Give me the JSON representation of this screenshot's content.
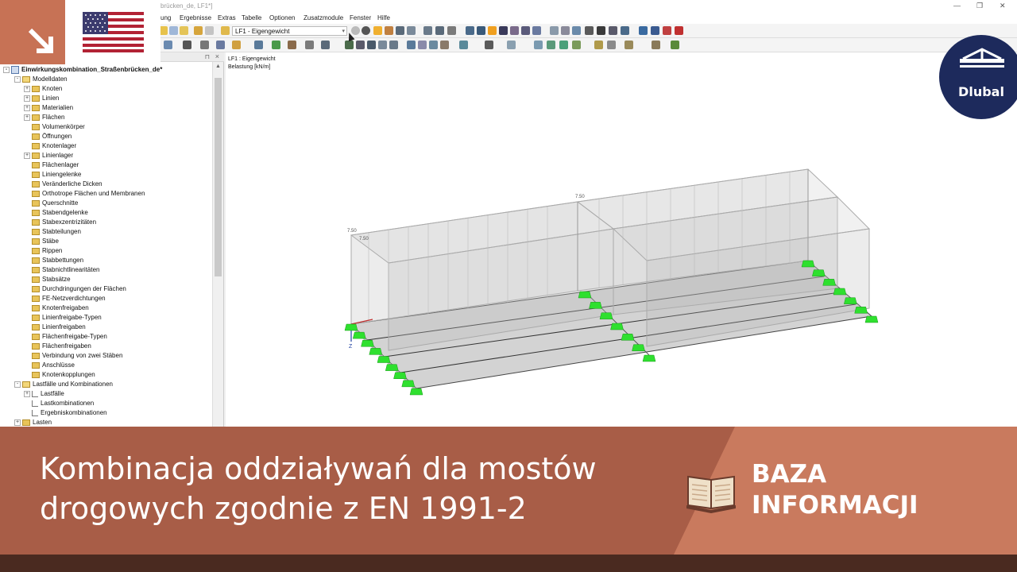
{
  "window": {
    "title": "brücken_de, LF1*]",
    "controls": [
      "—",
      "❐",
      "✕"
    ]
  },
  "menu": [
    "ung",
    "Ergebnisse",
    "Extras",
    "Tabelle",
    "Optionen",
    "Zusatzmodule",
    "Fenster",
    "Hilfe"
  ],
  "toolbar": {
    "loadcase_selected": "LF1 - Eigengewicht"
  },
  "navigator": {
    "root": "Einwirkungskombination_Straßenbrücken_de*",
    "items": [
      {
        "label": "Modelldaten",
        "level": 1,
        "type": "folder-open",
        "expander": "-"
      },
      {
        "label": "Knoten",
        "level": 2,
        "type": "folder",
        "expander": "+"
      },
      {
        "label": "Linien",
        "level": 2,
        "type": "folder",
        "expander": "+"
      },
      {
        "label": "Materialien",
        "level": 2,
        "type": "folder",
        "expander": "+"
      },
      {
        "label": "Flächen",
        "level": 2,
        "type": "folder",
        "expander": "+"
      },
      {
        "label": "Volumenkörper",
        "level": 2,
        "type": "folder",
        "expander": ""
      },
      {
        "label": "Öffnungen",
        "level": 2,
        "type": "folder",
        "expander": ""
      },
      {
        "label": "Knotenlager",
        "level": 2,
        "type": "folder",
        "expander": ""
      },
      {
        "label": "Linienlager",
        "level": 2,
        "type": "folder",
        "expander": "+"
      },
      {
        "label": "Flächenlager",
        "level": 2,
        "type": "folder",
        "expander": ""
      },
      {
        "label": "Liniengelenke",
        "level": 2,
        "type": "folder",
        "expander": ""
      },
      {
        "label": "Veränderliche Dicken",
        "level": 2,
        "type": "folder",
        "expander": ""
      },
      {
        "label": "Orthotrope Flächen und Membranen",
        "level": 2,
        "type": "folder",
        "expander": ""
      },
      {
        "label": "Querschnitte",
        "level": 2,
        "type": "folder",
        "expander": ""
      },
      {
        "label": "Stabendgelenke",
        "level": 2,
        "type": "folder",
        "expander": ""
      },
      {
        "label": "Stabexzentrizitäten",
        "level": 2,
        "type": "folder",
        "expander": ""
      },
      {
        "label": "Stabteilungen",
        "level": 2,
        "type": "folder",
        "expander": ""
      },
      {
        "label": "Stäbe",
        "level": 2,
        "type": "folder",
        "expander": ""
      },
      {
        "label": "Rippen",
        "level": 2,
        "type": "folder",
        "expander": ""
      },
      {
        "label": "Stabbettungen",
        "level": 2,
        "type": "folder",
        "expander": ""
      },
      {
        "label": "Stabnichtlinearitäten",
        "level": 2,
        "type": "folder",
        "expander": ""
      },
      {
        "label": "Stabsätze",
        "level": 2,
        "type": "folder",
        "expander": ""
      },
      {
        "label": "Durchdringungen der Flächen",
        "level": 2,
        "type": "folder",
        "expander": ""
      },
      {
        "label": "FE-Netzverdichtungen",
        "level": 2,
        "type": "folder",
        "expander": ""
      },
      {
        "label": "Knotenfreigaben",
        "level": 2,
        "type": "folder",
        "expander": ""
      },
      {
        "label": "Linienfreigabe-Typen",
        "level": 2,
        "type": "folder",
        "expander": ""
      },
      {
        "label": "Linienfreigaben",
        "level": 2,
        "type": "folder",
        "expander": ""
      },
      {
        "label": "Flächenfreigabe-Typen",
        "level": 2,
        "type": "folder",
        "expander": ""
      },
      {
        "label": "Flächenfreigaben",
        "level": 2,
        "type": "folder",
        "expander": ""
      },
      {
        "label": "Verbindung von zwei Stäben",
        "level": 2,
        "type": "folder",
        "expander": ""
      },
      {
        "label": "Anschlüsse",
        "level": 2,
        "type": "folder",
        "expander": ""
      },
      {
        "label": "Knotenkopplungen",
        "level": 2,
        "type": "folder",
        "expander": ""
      },
      {
        "label": "Lastfälle und Kombinationen",
        "level": 1,
        "type": "folder-open",
        "expander": "-"
      },
      {
        "label": "Lastfälle",
        "level": 2,
        "type": "item",
        "expander": "+"
      },
      {
        "label": "Lastkombinationen",
        "level": 2,
        "type": "item",
        "expander": ""
      },
      {
        "label": "Ergebniskombinationen",
        "level": 2,
        "type": "item",
        "expander": ""
      },
      {
        "label": "Lasten",
        "level": 1,
        "type": "folder",
        "expander": "+"
      }
    ]
  },
  "viewport": {
    "loadcase_label": "LF1 : Eigengewicht",
    "load_unit": "Belastung [kN/m]",
    "dimension_labels": [
      "7.50",
      "7.50",
      "7.50"
    ],
    "axis_label": "Z"
  },
  "branding": {
    "logo_text": "Dlubal",
    "language_flag": "us-flag-icon",
    "badge_icon": "arrow-down-right-icon"
  },
  "banner": {
    "headline_line1": "Kombinacja oddziaływań dla mostów",
    "headline_line2": "drogowych zgodnie z EN 1991-2",
    "kb_line1": "BAZA",
    "kb_line2": "INFORMACJI"
  },
  "colors": {
    "badge": "#c77255",
    "banner": "#a85d47",
    "banner_right": "#c97a5e",
    "banner_bottom": "#4a2a20",
    "logo": "#1d2a5c",
    "support_green": "#2fe02f"
  }
}
